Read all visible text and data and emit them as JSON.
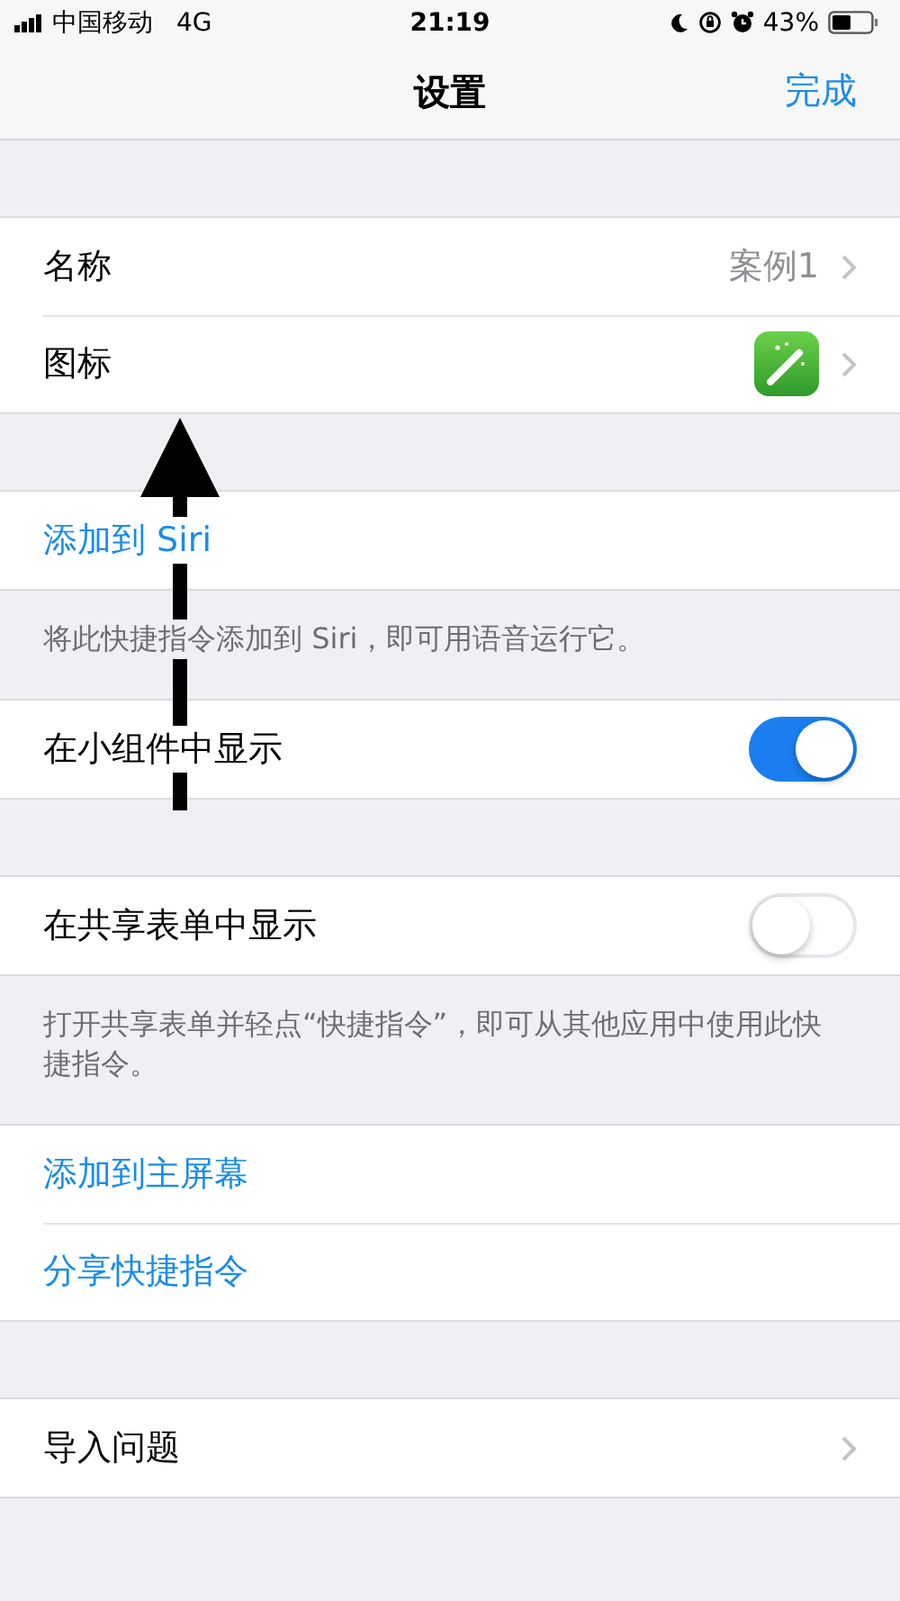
{
  "status_bar": {
    "carrier": "中国移动",
    "network": "4G",
    "time": "21:19",
    "battery": "43%"
  },
  "nav": {
    "title": "设置",
    "done": "完成"
  },
  "groups": [
    {
      "rows": [
        {
          "kind": "value",
          "label": "名称",
          "value": "案例1"
        },
        {
          "kind": "icon",
          "label": "图标"
        }
      ]
    },
    {
      "rows": [
        {
          "kind": "action",
          "label": "添加到 Siri"
        }
      ],
      "footer": "将此快捷指令添加到 Siri，即可用语音运行它。"
    },
    {
      "rows": [
        {
          "kind": "toggle",
          "label": "在小组件中显示",
          "on": true
        }
      ]
    },
    {
      "rows": [
        {
          "kind": "toggle",
          "label": "在共享表单中显示",
          "on": false
        }
      ],
      "footer": "打开共享表单并轻点“快捷指令”，即可从其他应用中使用此快捷指令。"
    },
    {
      "rows": [
        {
          "kind": "action",
          "label": "添加到主屏幕"
        },
        {
          "kind": "action",
          "label": "分享快捷指令"
        }
      ]
    },
    {
      "rows": [
        {
          "kind": "link",
          "label": "导入问题"
        }
      ]
    }
  ]
}
